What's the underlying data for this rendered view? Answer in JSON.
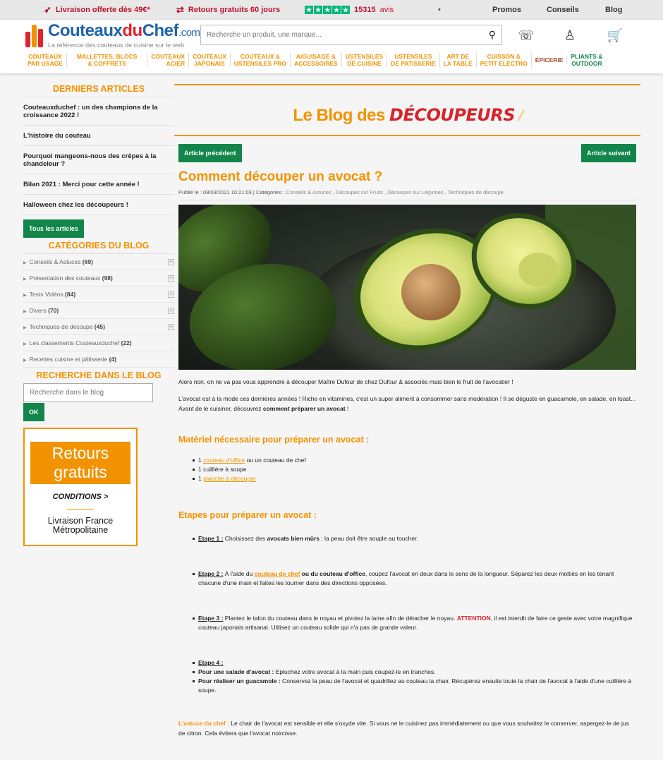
{
  "topbar": {
    "delivery": "Livraison offerte dès 49€*",
    "returns": "Retours gratuits 60 jours",
    "reviews_count": "15315",
    "reviews_word": "avis",
    "dot": "•",
    "links": [
      "Promos",
      "Conseils",
      "Blog"
    ]
  },
  "header": {
    "brand_a": "Couteaux",
    "brand_b": "du",
    "brand_c": "Chef",
    "brand_tld": ".com",
    "tagline": "La référence des couteaux de cuisine sur le web",
    "search_placeholder": "Recherche un produit, une marque..."
  },
  "nav": [
    [
      "COUTEAUX",
      "PAR USAGE"
    ],
    [
      "MALLETTES, BLOCS",
      "& COFFRETS"
    ],
    [
      "COUTEAUX",
      "ACIER"
    ],
    [
      "COUTEAUX",
      "JAPONAIS"
    ],
    [
      "COUTEAUX &",
      "USTENSILES PRO"
    ],
    [
      "AIGUISAGE &",
      "ACCESSOIRES"
    ],
    [
      "USTENSILES",
      "DE CUISINE"
    ],
    [
      "USTENSILES",
      "DE PATISSERIE"
    ],
    [
      "ART DE",
      "LA TABLE"
    ],
    [
      "CUISSON &",
      "PETIT ELECTRO"
    ],
    [
      "ÉPICERIE",
      ""
    ],
    [
      "PLIANTS &",
      "OUTDOOR"
    ]
  ],
  "sidebar": {
    "latest_title": "DERNIERS ARTICLES",
    "articles": [
      "Couteauxduchef : un des champions de la croissance 2022 !",
      "L'histoire du couteau",
      "Pourquoi mangeons-nous des crêpes à la chandeleur ?",
      "Bilan 2021 : Merci pour cette année !",
      "Halloween chez les découpeurs !"
    ],
    "all_articles": "Tous les articles",
    "categories_title": "CATÉGORIES DU BLOG",
    "categories": [
      {
        "name": "Conseils & Astuces",
        "count": "(69)"
      },
      {
        "name": "Présentation des couteaux",
        "count": "(98)"
      },
      {
        "name": "Tests Vidéos",
        "count": "(84)"
      },
      {
        "name": "Divers",
        "count": "(70)"
      },
      {
        "name": "Techniques de découpe",
        "count": "(45)"
      },
      {
        "name": "Les classements Couteauxduchef",
        "count": "(22)"
      },
      {
        "name": "Recettes cuisine et pâtisserie",
        "count": "(4)"
      }
    ],
    "search_title": "RECHERCHE DANS LE BLOG",
    "search_placeholder": "Recherche dans le blog",
    "ok": "OK",
    "promo": {
      "line1": "Retours",
      "line2": "gratuits",
      "conditions": "CONDITIONS >",
      "liv1": "Livraison France",
      "liv2": "Métropolitaine"
    }
  },
  "main": {
    "blog_a": "Le Blog des ",
    "blog_b": "DÉCOUPEURS",
    "prev": "Article précédent",
    "next": "Article suivant",
    "title": "Comment découper un avocat ?",
    "meta_pub": "Publié le : 08/03/2021 10:21:03 | Catégories : ",
    "meta_cats": "Conseils & Astuces , Découpes sur Fruits , Découpes sur Légumes , Techniques de découpe",
    "p1": "Alors non, on ne va pas vous apprendre à découper Maître Dufour de chez Dufour & associés mais bien le fruit de l'avocatier !",
    "p2a": "L'avocat est à la mode ces dernières années ! Riche en vitamines, c'est un super aliment à consommer sans modération !  Il se déguste en guacamole, en salade, en toast...  Avant de le cuisiner, découvrez ",
    "p2b": "comment préparer un avocat",
    "p2c": " !",
    "h_mat": "Matériel nécessaire pour préparer un avocat :",
    "mat1a": "1 ",
    "mat1b": "couteau d'office",
    "mat1c": " ou un couteau de chef",
    "mat2": "1 cuillière à soupe",
    "mat3a": "1 ",
    "mat3b": "planche à découper",
    "h_steps": "Etapes pour préparer un avocat :",
    "s1l": "Etape 1 :",
    "s1a": " Choisissez des ",
    "s1b": "avocats bien mûrs",
    "s1c": " : la peau doit être souple au toucher.",
    "s2l": "Etape 2 :",
    "s2a": " À l'aide du ",
    "s2b": "couteau de chef",
    "s2c": " ou du couteau d'office",
    "s2d": ", coupez l'avocat en deux dans le sens de la longueur. Séparez les deux moitiés en les tenant chacune d'une main et faites les tourner dans des directions opposées.",
    "s3l": "Etape 3 :",
    "s3a": " Plantez le talon du couteau dans le noyau et pivotez la lame afin de détacher le noyau. ",
    "s3b": "ATTENTION",
    "s3c": ", il est interdit de faire ce geste avec votre magnifique couteau japonais artisanal. Utilisez un couteau solide qui n'a pas de grande valeur.",
    "s4l": "Etape 4 :",
    "s4ab": "Pour une salade d'avocat :",
    "s4a": " Epluchez votre avocat à la main puis coupez-le en tranches.",
    "s4bb": "Pour réaliser un guacamole :",
    "s4b": " Conservez la peau de l'avocat et quadrillez au couteau la chair. Récupérez ensuite toute la chair de l'avocat à l'aide d'une cuillière à soupe.",
    "tip_l": "L'astuce du chef :",
    "tip": " Le chair de l'avocat est sensible et elle s'oxyde vite. Si vous ne le cuisinez pas immédiatement ou que vous souhaitez le conserver, aspergez-le de jus de citron. Cela évitera que l'avocat noircisse."
  },
  "colors": {
    "accent": "#f39200",
    "green": "#12864a",
    "red": "#d8232a",
    "brand_blue": "#1f63ad"
  }
}
